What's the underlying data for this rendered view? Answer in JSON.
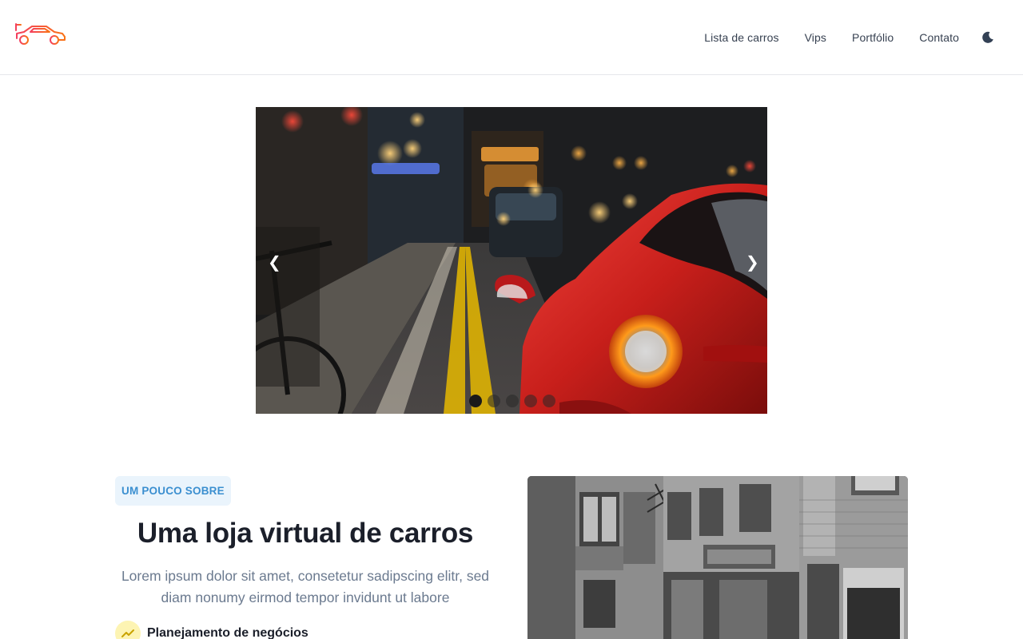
{
  "header": {
    "logo_icon": "race-car-icon",
    "nav": [
      {
        "label": "Lista de carros"
      },
      {
        "label": "Vips"
      },
      {
        "label": "Portfólio"
      },
      {
        "label": "Contato"
      }
    ],
    "theme_icon": "moon-icon"
  },
  "carousel": {
    "prev_label": "❮",
    "next_label": "❯",
    "slide_count": 5,
    "active_slide": 1
  },
  "about": {
    "badge": "UM POUCO SOBRE",
    "title": "Uma loja virtual de carros",
    "text": "Lorem ipsum dolor sit amet, consetetur sadipscing elitr, sed diam nonumy eirmod tempor invidunt ut labore",
    "feature_icon": "trend-chart-icon",
    "feature_label": "Planejamento de negócios"
  },
  "colors": {
    "brand": "#ef4444",
    "badge_text": "#3b8fd0",
    "badge_bg": "#eaf4fc",
    "feature_icon_bg": "#fdf4b3"
  }
}
